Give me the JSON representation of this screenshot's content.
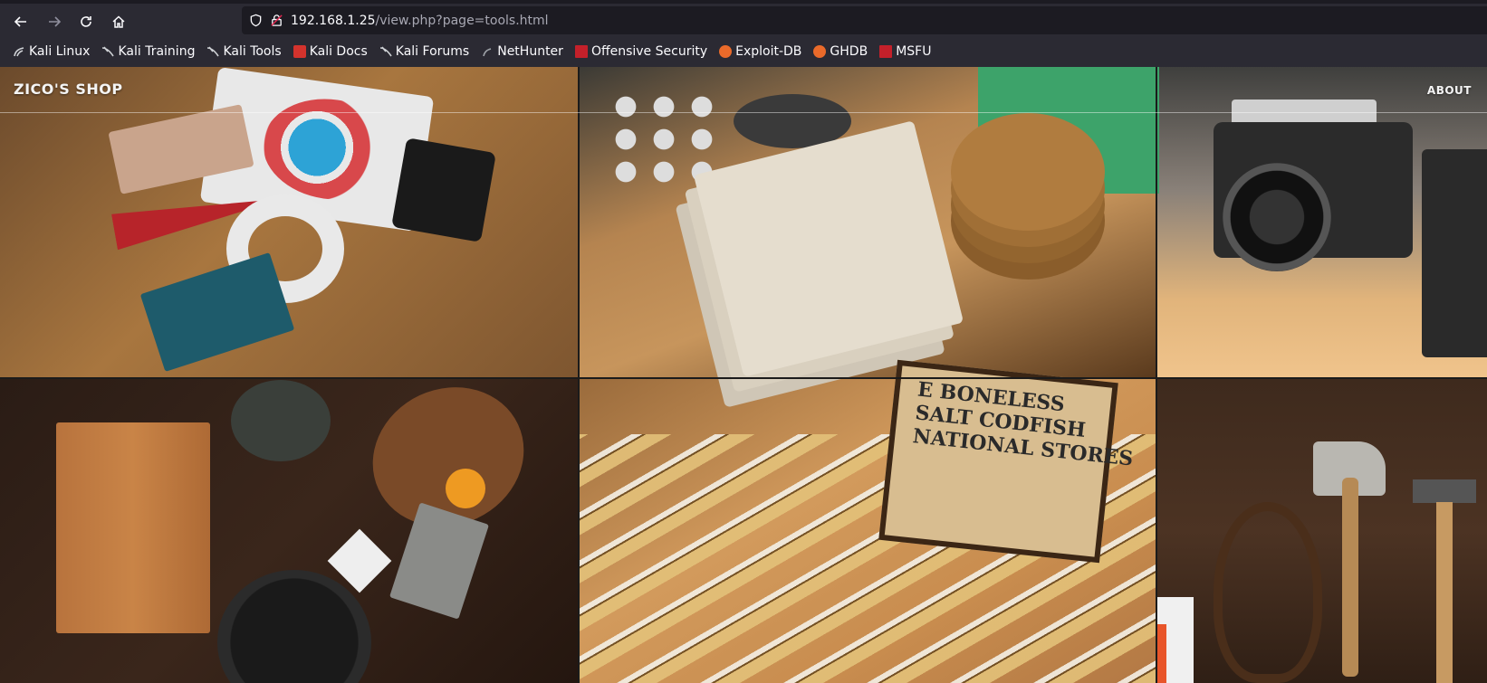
{
  "browser": {
    "url_host": "192.168.1.25",
    "url_path": "/view.php?page=tools.html",
    "bookmarks": [
      {
        "label": "Kali Linux",
        "icon": "kali-dragon-icon"
      },
      {
        "label": "Kali Training",
        "icon": "kali-dragon-icon"
      },
      {
        "label": "Kali Tools",
        "icon": "kali-dragon-icon"
      },
      {
        "label": "Kali Docs",
        "icon": "kali-docs-icon"
      },
      {
        "label": "Kali Forums",
        "icon": "kali-dragon-icon"
      },
      {
        "label": "NetHunter",
        "icon": "nethunter-icon"
      },
      {
        "label": "Offensive Security",
        "icon": "offsec-icon"
      },
      {
        "label": "Exploit-DB",
        "icon": "exploitdb-icon"
      },
      {
        "label": "GHDB",
        "icon": "exploitdb-icon"
      },
      {
        "label": "MSFU",
        "icon": "offsec-icon"
      }
    ]
  },
  "site": {
    "brand": "ZICO'S SHOP",
    "nav_about": "ABOUT",
    "crate_text": "E BONELESS\nSALT CODFISH\nNATIONAL STORES"
  },
  "colors": {
    "chrome_bg": "#2b2a33",
    "urlbar_bg": "#1c1b22",
    "text": "#fbfbfe"
  }
}
